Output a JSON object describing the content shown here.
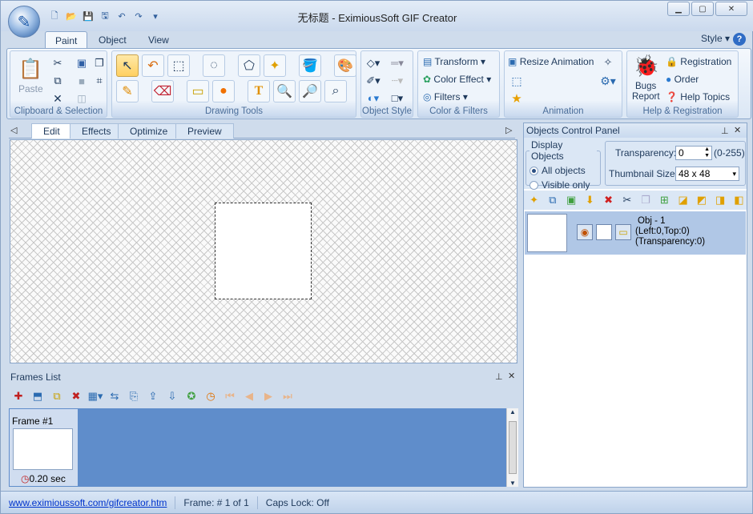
{
  "app": {
    "title": "无标题 - EximiousSoft GIF Creator"
  },
  "ribbon_tabs": [
    "Paint",
    "Object",
    "View"
  ],
  "style_label": "Style",
  "groups": {
    "clipboard": {
      "label": "Clipboard & Selection",
      "paste": "Paste"
    },
    "drawing": {
      "label": "Drawing Tools"
    },
    "object_style": {
      "label": "Object Style"
    },
    "color_filters": {
      "label": "Color & Filters",
      "transform": "Transform",
      "color_effect": "Color Effect",
      "filters": "Filters"
    },
    "animation": {
      "label": "Animation",
      "resize": "Resize Animation"
    },
    "help": {
      "label": "Help & Registration",
      "bugs": "Bugs",
      "report": "Report",
      "registration": "Registration",
      "order": "Order",
      "help_topics": "Help Topics"
    }
  },
  "doc_tabs": [
    "Edit",
    "Effects",
    "Optimize",
    "Preview"
  ],
  "frames": {
    "title": "Frames List",
    "frame_name": "Frame #1",
    "delay": "0.20 sec"
  },
  "objects_panel": {
    "title": "Objects Control Panel",
    "display_objects": "Display Objects",
    "all_objects": "All objects",
    "visible_only": "Visible only",
    "transparency_label": "Transparency:",
    "transparency_value": "0",
    "transparency_range": "(0-255)",
    "thumbnail_label": "Thumbnail Size:",
    "thumbnail_value": "48 x 48",
    "object": {
      "name": "Obj - 1",
      "position": "(Left:0,Top:0)",
      "transparency": "(Transparency:0)"
    }
  },
  "status": {
    "link": "www.eximioussoft.com/gifcreator.htm",
    "frame": "Frame: # 1 of 1",
    "caps": "Caps Lock: Off"
  }
}
